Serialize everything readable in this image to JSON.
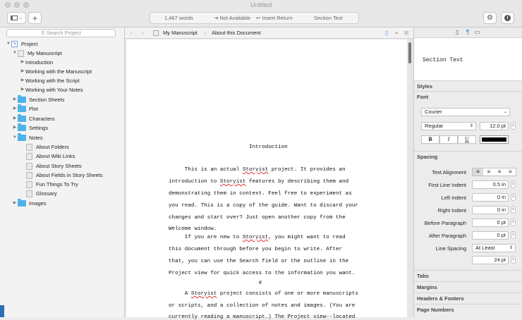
{
  "window": {
    "title": "Untitled"
  },
  "toolbar": {
    "word_count": "1,467 words",
    "not_available": "⇥ Not Available",
    "insert_return": "↩ Insert Return",
    "section_type": "Section Text"
  },
  "sidebar": {
    "search_placeholder": "Search Project",
    "items": [
      {
        "label": "Project"
      },
      {
        "label": "My Manuscript"
      },
      {
        "label": "Introduction"
      },
      {
        "label": "Working with the Manuscript"
      },
      {
        "label": "Working with the Script"
      },
      {
        "label": "Working with Your Notes"
      },
      {
        "label": "Section Sheets"
      },
      {
        "label": "Plot"
      },
      {
        "label": "Characters"
      },
      {
        "label": "Settings"
      },
      {
        "label": "Notes"
      },
      {
        "label": "About Folders"
      },
      {
        "label": "About Wiki Links"
      },
      {
        "label": "About Story Sheets"
      },
      {
        "label": "About Fields in Story Sheets"
      },
      {
        "label": "Fun Things To Try"
      },
      {
        "label": "Glossary"
      },
      {
        "label": "Images"
      }
    ]
  },
  "nav": {
    "crumb1": "My Manuscript",
    "sep": ":",
    "crumb2": "About this Document"
  },
  "document": {
    "heading": "Introduction",
    "lines": [
      "     This is an actual Storyist project. It provides an",
      "introduction to Storyist features by describing them and",
      "demonstrating them in context. Feel free to experiment as",
      "you read. This is a copy of the guide. Want to discard your",
      "changes and start over? Just open another copy from the",
      "Welcome window.",
      "     If you are new to Storyist, you might want to read",
      "this document through before you begin to write. After",
      "that, you can use the Search field or the outline in the",
      "Project view for quick access to the information you want.",
      "                            #",
      "     A Storyist project consists of one or more manuscripts",
      "or scripts, and a collection of notes and images. (You are",
      "currently reading a manuscript.) The Project view--located"
    ]
  },
  "inspector": {
    "preview_text": "Section Text",
    "styles": "Styles",
    "font": "Font",
    "font_family": "Courier",
    "font_style": "Regular",
    "font_size": "12.0 pt",
    "bold": "B",
    "italic": "I",
    "underline": "U",
    "spacing": "Spacing",
    "text_alignment": "Text Alignment",
    "first_line_indent_label": "First Line Indent",
    "first_line_indent": "0.5 in",
    "left_indent_label": "Left Indent",
    "left_indent": "0 in",
    "right_indent_label": "Right Indent",
    "right_indent": "0 in",
    "before_paragraph_label": "Before Paragraph",
    "before_paragraph": "0 pt",
    "after_paragraph_label": "After Paragraph",
    "after_paragraph": "0 pt",
    "line_spacing_label": "Line Spacing",
    "line_spacing": "At Least",
    "line_spacing_value": "24 pt",
    "tabs": "Tabs",
    "margins": "Margins",
    "headers_footers": "Headers & Footers",
    "page_numbers": "Page Numbers",
    "text_color": "#000000"
  }
}
